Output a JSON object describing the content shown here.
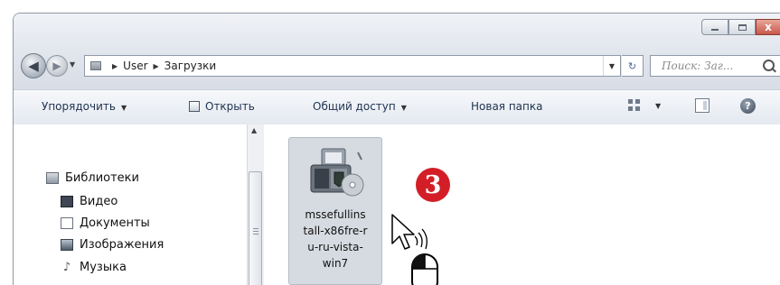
{
  "window": {
    "caption_buttons": {
      "minimize_icon": "minimize-icon",
      "maximize_icon": "maximize-icon",
      "close_glyph": "x"
    }
  },
  "navbar": {
    "back_glyph": "◀",
    "forward_glyph": "▶",
    "history_glyph": "▼",
    "address": {
      "crumbs": [
        "User",
        "Загрузки"
      ],
      "separator": "▶",
      "dropdown_glyph": "▼"
    },
    "refresh_glyph": "↻",
    "search": {
      "placeholder": "Поиск: Заг...",
      "icon": "search-icon"
    }
  },
  "toolbar": {
    "organize": "Упорядочить",
    "open": "Открыть",
    "share": "Общий доступ",
    "new_folder": "Новая папка",
    "dropdown_glyph": "▼",
    "help_glyph": "?"
  },
  "nav_pane": {
    "libraries": "Библиотеки",
    "items": [
      "Видео",
      "Документы",
      "Изображения",
      "Музыка"
    ]
  },
  "scrollbar": {
    "up_glyph": "▲"
  },
  "content": {
    "file": {
      "name": "mssefullins\ntall-x86fre-r\nu-ru-vista-\nwin7"
    },
    "step_badge": "3"
  },
  "colors": {
    "accent_red": "#d41e27",
    "selection": "#d6dbe1",
    "toolbar_text": "#1e3250"
  }
}
